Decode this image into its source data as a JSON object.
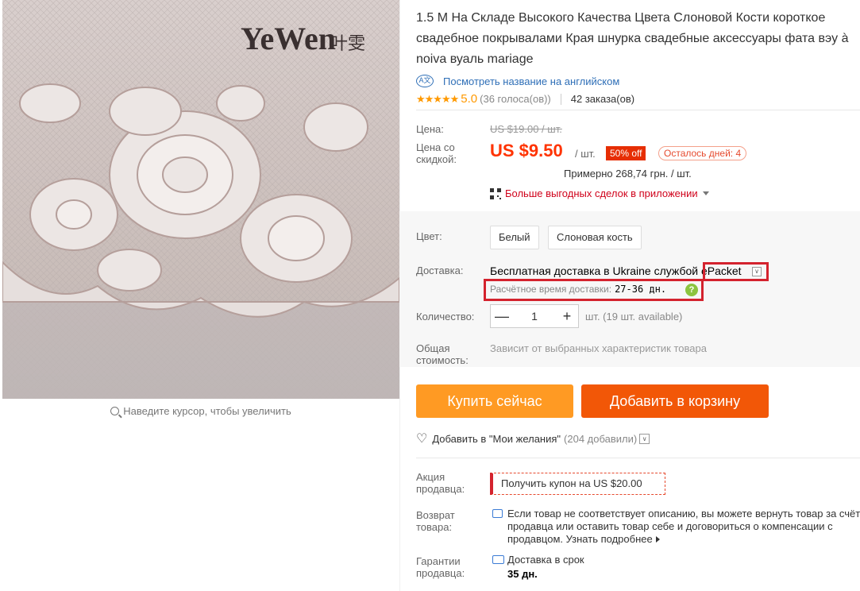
{
  "gallery": {
    "brand_logo": "YeWen",
    "brand_logo_cjk": "叶雯",
    "zoom_hint": "Наведите курсор, чтобы увеличить"
  },
  "product": {
    "title": "1.5 М На Складе Высокого Качества Цвета Слоновой Кости короткое свадебное покрывалами Края шнурка свадебные аксессуары фата вэу à noiva вуаль mariage",
    "english_link": "Посмотреть название на английском",
    "rating": {
      "stars": "★★★★★",
      "value": "5.0",
      "votes": "(36 голоса(ов))",
      "orders": "42 заказа(ов)"
    }
  },
  "pricing": {
    "price_label": "Цена:",
    "old_price": "US $19.00 / шт.",
    "discount_label": "Цена со скидкой:",
    "price": "US $9.50",
    "unit": "/ шт.",
    "discount_badge": "50% off",
    "days_left": "Осталось дней: 4",
    "approx": "Примерно 268,74 грн. / шт.",
    "app_deals": "Больше выгодных сделок в приложении"
  },
  "options": {
    "color_label": "Цвет:",
    "colors": [
      "Белый",
      "Слоновая кость"
    ],
    "shipping_label": "Доставка:",
    "shipping_text": "Бесплатная доставка в Ukraine службой ePacket",
    "eta_label": "Расчётное время доставки:",
    "eta_days": "27-36 дн.",
    "eta_help": "?",
    "qty_label": "Количество:",
    "qty_minus": "—",
    "qty_value": "1",
    "qty_plus": "+",
    "qty_available": "шт. (19 шт. available)",
    "total_label": "Общая стоимость:",
    "total_note": "Зависит от выбранных характеристик товара"
  },
  "actions": {
    "buy_now": "Купить сейчас",
    "add_to_cart": "Добавить в корзину",
    "wishlist": "Добавить в \"Мои желания\"",
    "wishlist_count": "(204 добавили)"
  },
  "seller": {
    "promo_label": "Акция продавца:",
    "coupon": "Получить купон на US $20.00",
    "return_label": "Возврат товара:",
    "return_text": "Если товар не соответствует описанию, вы можете вернуть товар за счёт продавца или оставить товар себе и договориться о компенсации с продавцом.",
    "learn_more": "Узнать подробнее",
    "guarantee_label": "Гарантии продавца:",
    "guarantee_line1": "Доставка в срок",
    "guarantee_line2": "35 дн."
  },
  "colors": {
    "price_red": "#ff3300",
    "buy_now_orange": "#ff9a23",
    "cart_orange": "#f25707",
    "highlight_red": "#d4232e",
    "link_blue": "#2f6fb7"
  }
}
